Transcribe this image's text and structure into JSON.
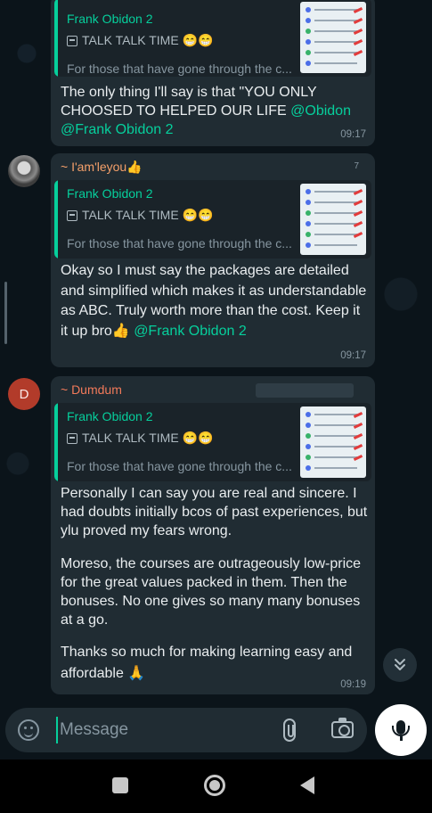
{
  "messages": [
    {
      "quote": {
        "author": "Frank Obidon 2",
        "title": "TALK TALK TIME 😁😁",
        "desc": "For those that have gone through the c..."
      },
      "body": [
        {
          "text": "The only thing I'll say is that \"YOU ONLY CHOOSED TO HELPED OUR LIFE "
        },
        {
          "mention": "@Obidon @Frank Obidon 2"
        }
      ],
      "time": "09:17"
    },
    {
      "sender": "~ I'am'leyou👍",
      "sender_extra": "7",
      "quote": {
        "author": "Frank Obidon 2",
        "title": "TALK TALK TIME 😁😁",
        "desc": "For those that have gone through the c..."
      },
      "body": [
        {
          "text": "Okay so I must say the packages are detailed and simplified which makes it as understandable as ABC. Truly worth more than the cost. Keep it it up bro👍 "
        },
        {
          "mention": "@Frank Obidon 2"
        }
      ],
      "time": "09:17"
    },
    {
      "avatar_letter": "D",
      "sender": "~ Dumdum",
      "quote": {
        "author": "Frank Obidon 2",
        "title": "TALK TALK TIME 😁😁",
        "desc": "For those that have gone through the c..."
      },
      "paragraphs": [
        "Personally I can say you are real and sincere. I had doubts initially bcos of past experiences, but ylu proved my fears wrong.",
        "Moreso, the courses are outrageously low-price for the great values packed in them. Then the bonuses. No one gives so many many bonuses at a go.",
        "Thanks so much for making learning easy and affordable 🙏"
      ],
      "time": "09:19"
    }
  ],
  "composer": {
    "placeholder": "Message"
  },
  "colors": {
    "background": "#0b141a",
    "bubble": "#202c33",
    "accent": "#06cf9c"
  },
  "icons": [
    "emoji-icon",
    "attach-icon",
    "camera-icon",
    "mic-icon",
    "chevrons-down-icon",
    "recents-icon",
    "home-icon",
    "back-icon"
  ]
}
